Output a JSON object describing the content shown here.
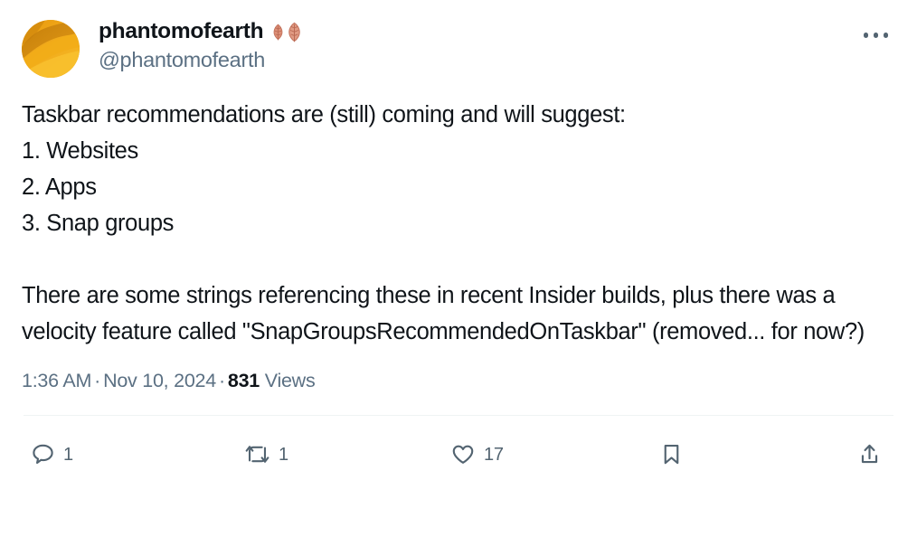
{
  "post": {
    "author": {
      "display_name": "phantomofearth",
      "handle": "@phantomofearth",
      "name_emoji": "fallen-leaf-emoji",
      "avatar": "orange-dune-avatar"
    },
    "text": "Taskbar recommendations are (still) coming and will suggest:\n1. Websites\n2. Apps\n3. Snap groups\n\nThere are some strings referencing these in recent Insider builds, plus there was a velocity feature called \"SnapGroupsRecommendedOnTaskbar\" (removed... for now?)",
    "meta": {
      "time": "1:36 AM",
      "separator_1": "·",
      "date": "Nov 10, 2024",
      "separator_2": "·",
      "views_count": "831",
      "views_label": "Views"
    },
    "actions": [
      {
        "name": "reply",
        "icon": "reply-icon",
        "count": "1"
      },
      {
        "name": "retweet",
        "icon": "retweet-icon",
        "count": "1"
      },
      {
        "name": "like",
        "icon": "heart-icon",
        "count": "17"
      },
      {
        "name": "bookmark",
        "icon": "bookmark-icon",
        "count": ""
      },
      {
        "name": "share",
        "icon": "share-icon",
        "count": ""
      }
    ],
    "more_options_label": "More"
  },
  "colors": {
    "text": "#0f1419",
    "muted": "#5b7083",
    "icon": "#536471",
    "divider": "#eff3f4",
    "background": "#ffffff",
    "avatar_accent": "#e8a317",
    "emoji_leaf": "#d98b76"
  }
}
